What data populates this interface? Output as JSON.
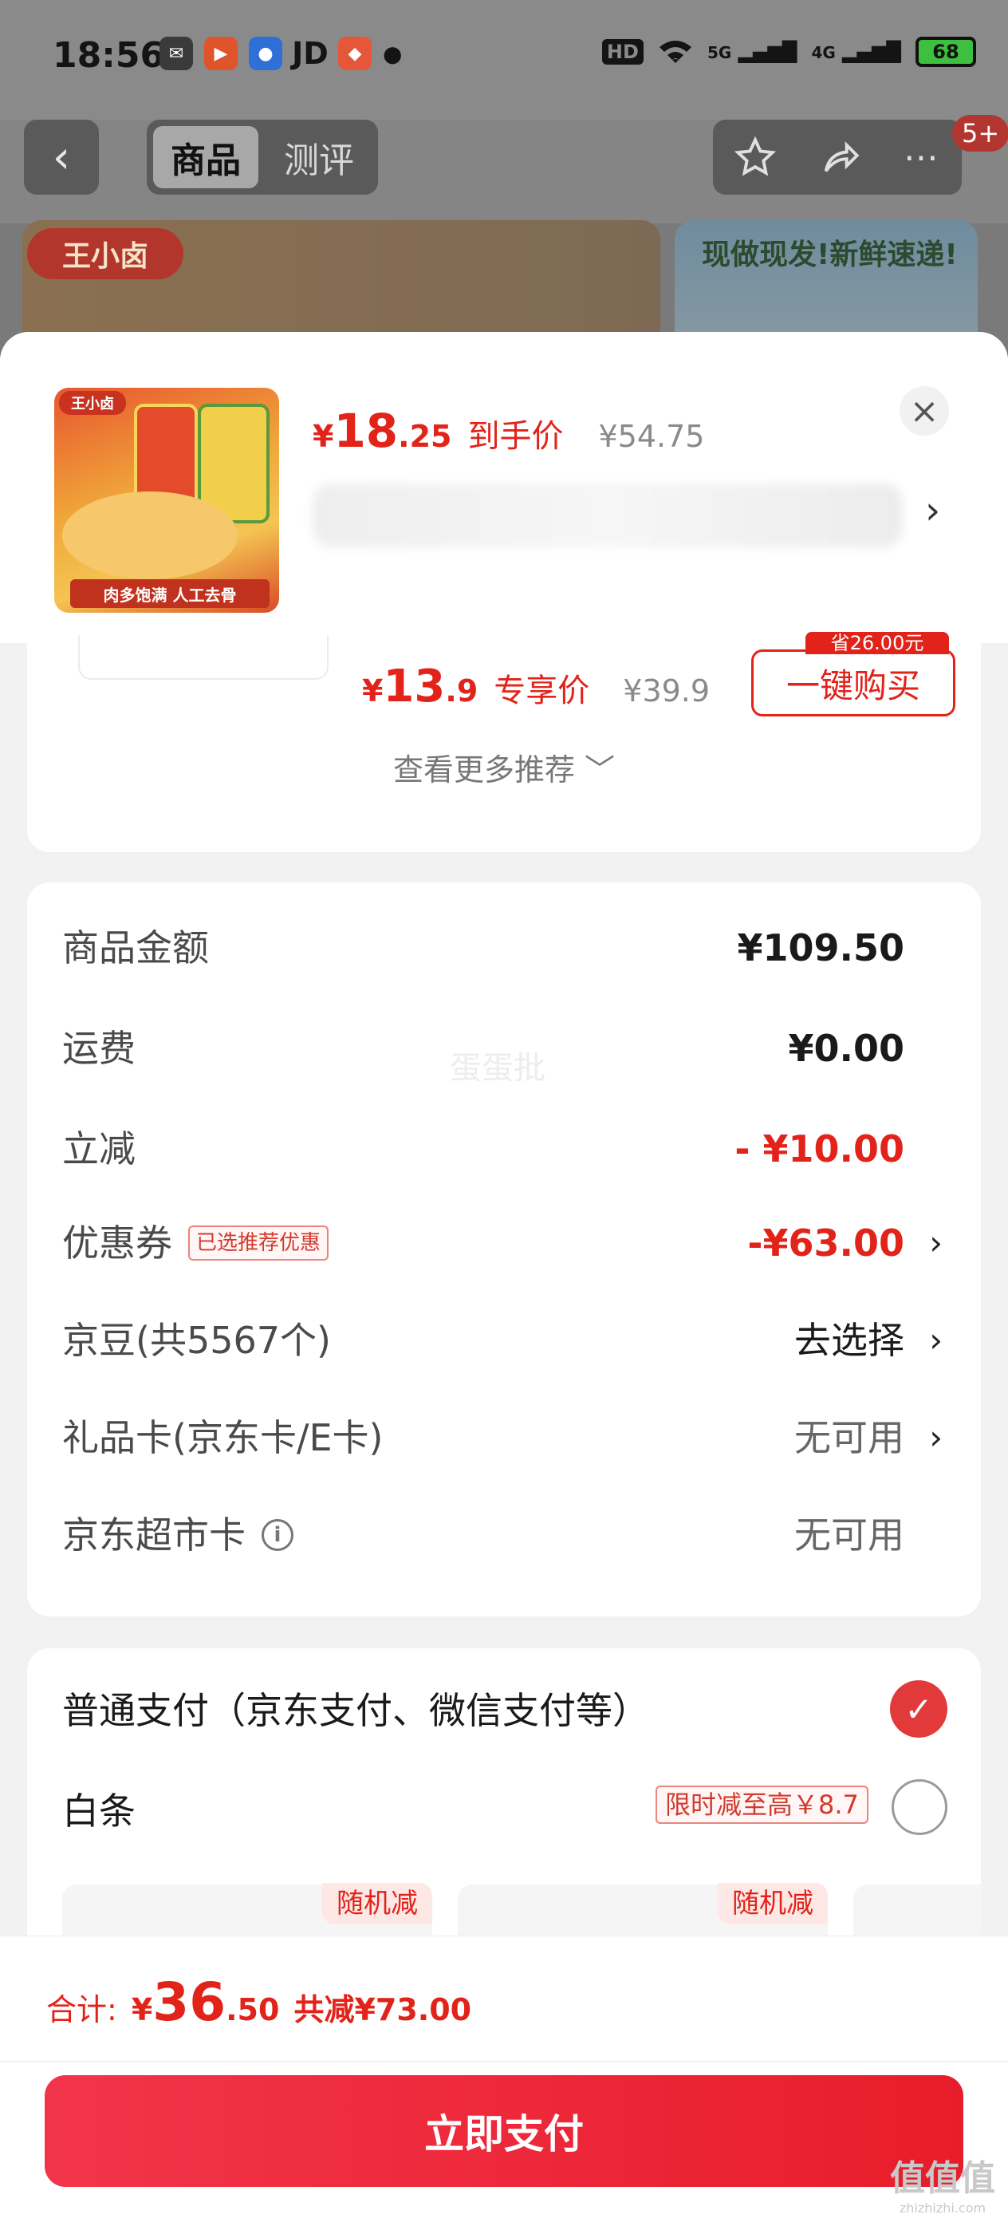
{
  "status_bar": {
    "time": "18:56",
    "jd_label": "JD",
    "network_5g": "5G",
    "network_4g": "4G",
    "battery": "68"
  },
  "nav": {
    "back_symbol": "‹",
    "tabs": [
      {
        "label": "商品"
      },
      {
        "label": "测评"
      }
    ],
    "badge": "5+"
  },
  "banner": {
    "logo_text": "王小卤",
    "promo_text": "现做现发!新鲜速递!"
  },
  "product": {
    "price_yen": "¥",
    "price_int": "18",
    "price_dec": ".25",
    "price_tag": "到手价",
    "original_price": "¥54.75",
    "thumb_logo": "王小卤",
    "thumb_caption": "肉多饱满 人工去骨"
  },
  "recommend": {
    "price_yen": "¥",
    "price_int": "13",
    "price_dec": ".9",
    "price_tag": "专享价",
    "original_price": "¥39.9",
    "buy_button": "一键购买",
    "buy_badge": "省26.00元",
    "more_label": "查看更多推荐 ﹀"
  },
  "summary": {
    "rows": [
      {
        "label": "商品金额",
        "value": "¥109.50"
      },
      {
        "label": "运费",
        "value": "¥0.00"
      },
      {
        "label": "立减",
        "value": "- ¥10.00"
      },
      {
        "label": "优惠券",
        "tag": "已选推荐优惠",
        "value": "-¥63.00"
      },
      {
        "label": "京豆(共5567个)",
        "value": "去选择"
      },
      {
        "label": "礼品卡(京东卡/E卡)",
        "value": "无可用"
      },
      {
        "label": "京东超市卡",
        "value": "无可用"
      }
    ],
    "watermark": "蛋蛋批"
  },
  "payment": {
    "normal_label": "普通支付（京东支付、微信支付等）",
    "baitiao_label": "白条",
    "baitiao_promo": "限时减至高￥8.7",
    "installment_badge": "随机减"
  },
  "footer": {
    "total_label": "合计:",
    "total_yen": "¥",
    "total_int": "36",
    "total_dec": ".50",
    "saved": "共减¥73.00",
    "pay_button": "立即支付"
  },
  "watermark_corner": {
    "main": "值值值",
    "url": "zhizhizhi.com"
  },
  "colors": {
    "accent": "#e2231a",
    "pay_button": "#f0263a",
    "check": "#e23a3a"
  },
  "icons": [
    "back-icon",
    "star-icon",
    "share-icon",
    "more-icon",
    "close-icon",
    "chevron-right-icon",
    "info-icon",
    "check-icon",
    "radio-icon"
  ]
}
